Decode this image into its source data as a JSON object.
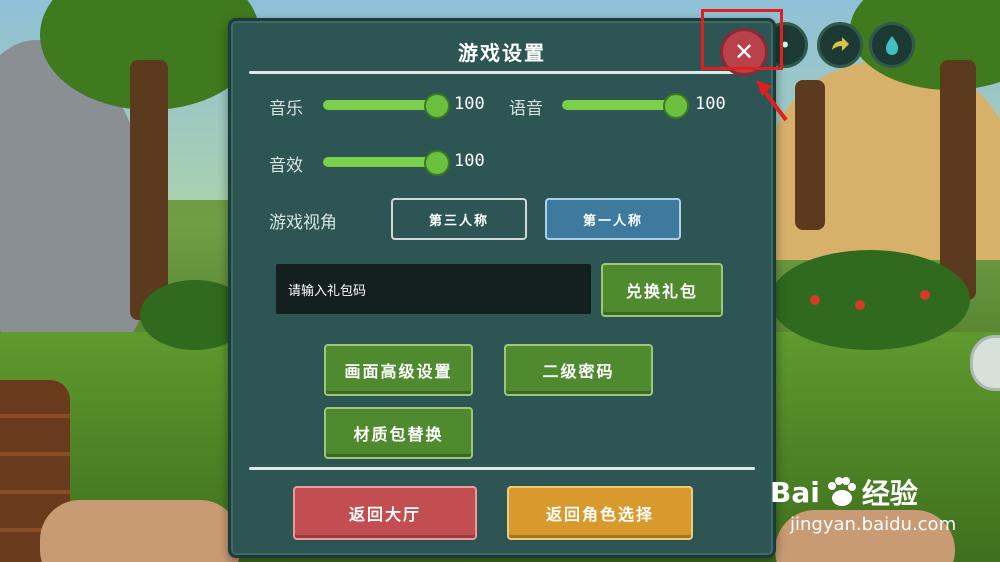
{
  "settings": {
    "title": "游戏设置",
    "close_icon": "close-icon",
    "music": {
      "label": "音乐",
      "value": "100",
      "level": 1.0
    },
    "voice": {
      "label": "语音",
      "value": "100",
      "level": 1.0
    },
    "sfx": {
      "label": "音效",
      "value": "100",
      "level": 1.0
    },
    "view": {
      "label": "游戏视角",
      "third_person": "第三人称",
      "first_person": "第一人称",
      "selected": "第一人称"
    },
    "gift": {
      "placeholder": "请输入礼包码",
      "redeem_label": "兑换礼包"
    },
    "graphics_label": "画面高级设置",
    "second_password_label": "二级密码",
    "texture_pack_label": "材质包替换",
    "back_lobby_label": "返回大厅",
    "back_character_label": "返回角色选择"
  },
  "hud": {
    "icons": [
      "hud-icon",
      "share-icon",
      "water-drop-icon"
    ]
  },
  "watermark": {
    "brand": "Bai",
    "brand_suffix": "经验",
    "url": "jingyan.baidu.com"
  },
  "colors": {
    "panel": "#2d5553",
    "slider_fill": "#7ad04a",
    "close": "#b8414a",
    "annotation": "#e02020"
  }
}
